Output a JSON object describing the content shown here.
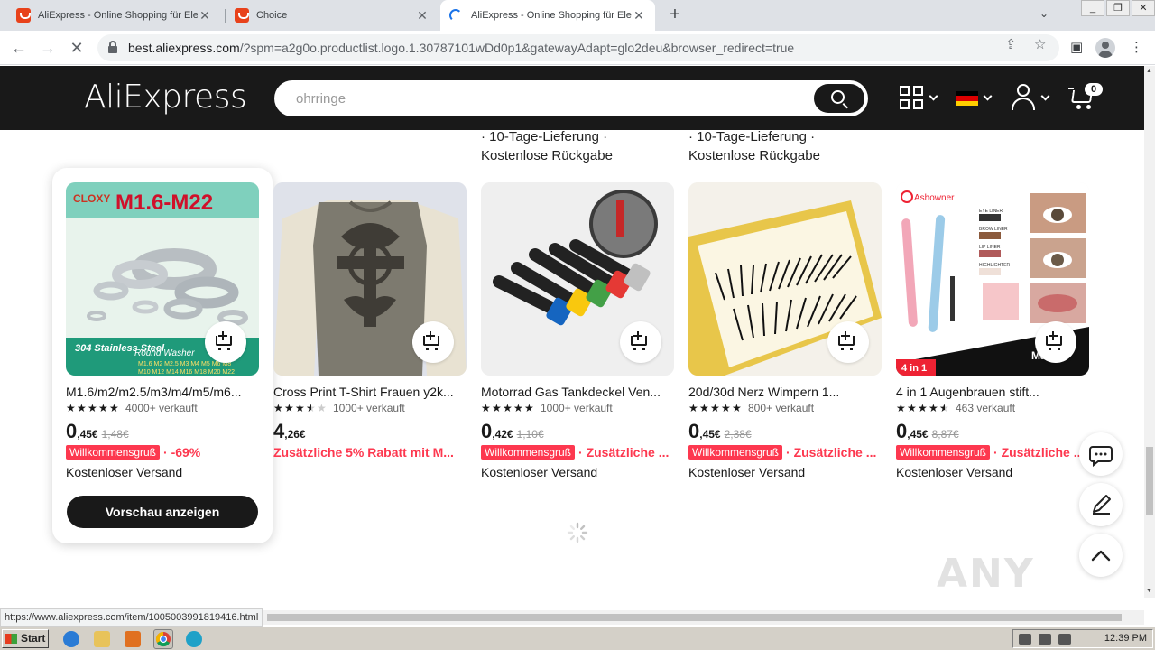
{
  "browser": {
    "tabs": [
      {
        "title": "AliExpress - Online Shopping für Elek",
        "active": false
      },
      {
        "title": "Choice",
        "active": false
      },
      {
        "title": "AliExpress - Online Shopping für Elek",
        "active": true
      }
    ],
    "url_host": "best.aliexpress.com",
    "url_path": "/?spm=a2g0o.productlist.logo.1.30787101wDd0p1&gatewayAdapt=glo2deu&browser_redirect=true",
    "status_url": "https://www.aliexpress.com/item/1005003991819416.html"
  },
  "header": {
    "logo": "AliExpress",
    "search_placeholder": "ohrringe",
    "cart_count": "0"
  },
  "prev_row": [
    {
      "line1": "· 10-Tage-Lieferung ·",
      "line2": "Kostenlose Rückgabe"
    },
    {
      "line1": "· 10-Tage-Lieferung ·",
      "line2": "Kostenlose Rückgabe"
    }
  ],
  "products": [
    {
      "title": "M1.6/m2/m2.5/m3/m4/m5/m6...",
      "stars": 5,
      "sold": "4000+ verkauft",
      "price_int": "0",
      "price_dec": ",45€",
      "orig": "1,48€",
      "tag": "Willkommensgruß",
      "promo": "· -69%",
      "shipping": "Kostenloser Versand",
      "image": "round-washers"
    },
    {
      "title": "Cross Print T-Shirt Frauen y2k...",
      "stars": 3.5,
      "sold": "1000+ verkauft",
      "price_int": "4",
      "price_dec": ",26€",
      "orig": "",
      "tag": "",
      "promo": "Zusätzliche 5% Rabatt mit M...",
      "shipping": "",
      "image": "cross-print-shirt"
    },
    {
      "title": "Motorrad Gas Tankdeckel Ven...",
      "stars": 5,
      "sold": "1000+ verkauft",
      "price_int": "0",
      "price_dec": ",42€",
      "orig": "1,10€",
      "tag": "Willkommensgruß",
      "promo": "· Zusätzliche ...",
      "shipping": "Kostenloser Versand",
      "image": "valve-caps"
    },
    {
      "title": "20d/30d Nerz Wimpern 1...",
      "stars": 5,
      "sold": "800+ verkauft",
      "price_int": "0",
      "price_dec": ",45€",
      "orig": "2,38€",
      "tag": "Willkommensgruß",
      "promo": "· Zusätzliche ...",
      "shipping": "Kostenloser Versand",
      "image": "eyelashes"
    },
    {
      "title": "4 in 1 Augenbrauen stift...",
      "stars": 4.5,
      "sold": "463 verkauft",
      "price_int": "0",
      "price_dec": ",45€",
      "orig": "8,87€",
      "tag": "Willkommensgruß",
      "promo": "· Zusätzliche ...",
      "shipping": "Kostenloser Versand",
      "image": "eyebrow-pen"
    }
  ],
  "image_text": {
    "washer_brand": "CLOXY",
    "washer_size": "M1.6-M22",
    "washer_material": "304 Stainless Steel",
    "washer_type": "Round Washer",
    "washer_sizes_1": "M1.6 M2 M2.5 M3 M4 M5 M6 M8",
    "washer_sizes_2": "M10 M12 M14 M16 M18 M20 M22",
    "pen_brand": "Ashowner",
    "pen_label_1": "EYE LINER",
    "pen_label_2": "BROW LINER",
    "pen_label_3": "LIP LINER",
    "pen_label_4": "HIGHLIGHTER",
    "pen_badge": "4 in 1",
    "pen_banner": "Mak"
  },
  "hover_card": {
    "button": "Vorschau anzeigen"
  },
  "watermark": "ANY RUN",
  "taskbar": {
    "start": "Start",
    "clock": "12:39 PM"
  },
  "colors": {
    "header_bg": "#191919",
    "promo_red": "#fd384f",
    "flag": [
      "#000000",
      "#dd0000",
      "#ffce00"
    ]
  }
}
